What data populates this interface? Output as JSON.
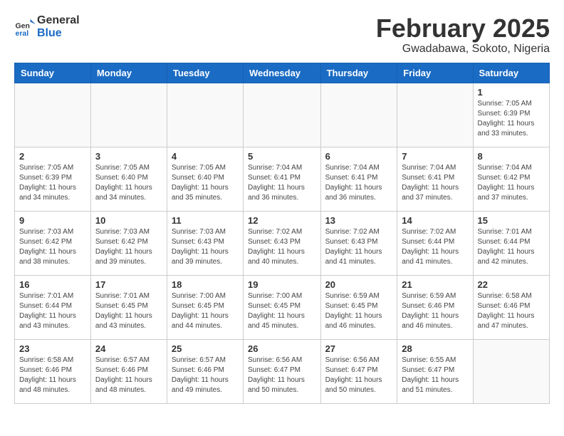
{
  "header": {
    "logo_general": "General",
    "logo_blue": "Blue",
    "month_title": "February 2025",
    "location": "Gwadabawa, Sokoto, Nigeria"
  },
  "days_of_week": [
    "Sunday",
    "Monday",
    "Tuesday",
    "Wednesday",
    "Thursday",
    "Friday",
    "Saturday"
  ],
  "weeks": [
    [
      {
        "day": "",
        "info": ""
      },
      {
        "day": "",
        "info": ""
      },
      {
        "day": "",
        "info": ""
      },
      {
        "day": "",
        "info": ""
      },
      {
        "day": "",
        "info": ""
      },
      {
        "day": "",
        "info": ""
      },
      {
        "day": "1",
        "info": "Sunrise: 7:05 AM\nSunset: 6:39 PM\nDaylight: 11 hours\nand 33 minutes."
      }
    ],
    [
      {
        "day": "2",
        "info": "Sunrise: 7:05 AM\nSunset: 6:39 PM\nDaylight: 11 hours\nand 34 minutes."
      },
      {
        "day": "3",
        "info": "Sunrise: 7:05 AM\nSunset: 6:40 PM\nDaylight: 11 hours\nand 34 minutes."
      },
      {
        "day": "4",
        "info": "Sunrise: 7:05 AM\nSunset: 6:40 PM\nDaylight: 11 hours\nand 35 minutes."
      },
      {
        "day": "5",
        "info": "Sunrise: 7:04 AM\nSunset: 6:41 PM\nDaylight: 11 hours\nand 36 minutes."
      },
      {
        "day": "6",
        "info": "Sunrise: 7:04 AM\nSunset: 6:41 PM\nDaylight: 11 hours\nand 36 minutes."
      },
      {
        "day": "7",
        "info": "Sunrise: 7:04 AM\nSunset: 6:41 PM\nDaylight: 11 hours\nand 37 minutes."
      },
      {
        "day": "8",
        "info": "Sunrise: 7:04 AM\nSunset: 6:42 PM\nDaylight: 11 hours\nand 37 minutes."
      }
    ],
    [
      {
        "day": "9",
        "info": "Sunrise: 7:03 AM\nSunset: 6:42 PM\nDaylight: 11 hours\nand 38 minutes."
      },
      {
        "day": "10",
        "info": "Sunrise: 7:03 AM\nSunset: 6:42 PM\nDaylight: 11 hours\nand 39 minutes."
      },
      {
        "day": "11",
        "info": "Sunrise: 7:03 AM\nSunset: 6:43 PM\nDaylight: 11 hours\nand 39 minutes."
      },
      {
        "day": "12",
        "info": "Sunrise: 7:02 AM\nSunset: 6:43 PM\nDaylight: 11 hours\nand 40 minutes."
      },
      {
        "day": "13",
        "info": "Sunrise: 7:02 AM\nSunset: 6:43 PM\nDaylight: 11 hours\nand 41 minutes."
      },
      {
        "day": "14",
        "info": "Sunrise: 7:02 AM\nSunset: 6:44 PM\nDaylight: 11 hours\nand 41 minutes."
      },
      {
        "day": "15",
        "info": "Sunrise: 7:01 AM\nSunset: 6:44 PM\nDaylight: 11 hours\nand 42 minutes."
      }
    ],
    [
      {
        "day": "16",
        "info": "Sunrise: 7:01 AM\nSunset: 6:44 PM\nDaylight: 11 hours\nand 43 minutes."
      },
      {
        "day": "17",
        "info": "Sunrise: 7:01 AM\nSunset: 6:45 PM\nDaylight: 11 hours\nand 43 minutes."
      },
      {
        "day": "18",
        "info": "Sunrise: 7:00 AM\nSunset: 6:45 PM\nDaylight: 11 hours\nand 44 minutes."
      },
      {
        "day": "19",
        "info": "Sunrise: 7:00 AM\nSunset: 6:45 PM\nDaylight: 11 hours\nand 45 minutes."
      },
      {
        "day": "20",
        "info": "Sunrise: 6:59 AM\nSunset: 6:45 PM\nDaylight: 11 hours\nand 46 minutes."
      },
      {
        "day": "21",
        "info": "Sunrise: 6:59 AM\nSunset: 6:46 PM\nDaylight: 11 hours\nand 46 minutes."
      },
      {
        "day": "22",
        "info": "Sunrise: 6:58 AM\nSunset: 6:46 PM\nDaylight: 11 hours\nand 47 minutes."
      }
    ],
    [
      {
        "day": "23",
        "info": "Sunrise: 6:58 AM\nSunset: 6:46 PM\nDaylight: 11 hours\nand 48 minutes."
      },
      {
        "day": "24",
        "info": "Sunrise: 6:57 AM\nSunset: 6:46 PM\nDaylight: 11 hours\nand 48 minutes."
      },
      {
        "day": "25",
        "info": "Sunrise: 6:57 AM\nSunset: 6:46 PM\nDaylight: 11 hours\nand 49 minutes."
      },
      {
        "day": "26",
        "info": "Sunrise: 6:56 AM\nSunset: 6:47 PM\nDaylight: 11 hours\nand 50 minutes."
      },
      {
        "day": "27",
        "info": "Sunrise: 6:56 AM\nSunset: 6:47 PM\nDaylight: 11 hours\nand 50 minutes."
      },
      {
        "day": "28",
        "info": "Sunrise: 6:55 AM\nSunset: 6:47 PM\nDaylight: 11 hours\nand 51 minutes."
      },
      {
        "day": "",
        "info": ""
      }
    ]
  ]
}
